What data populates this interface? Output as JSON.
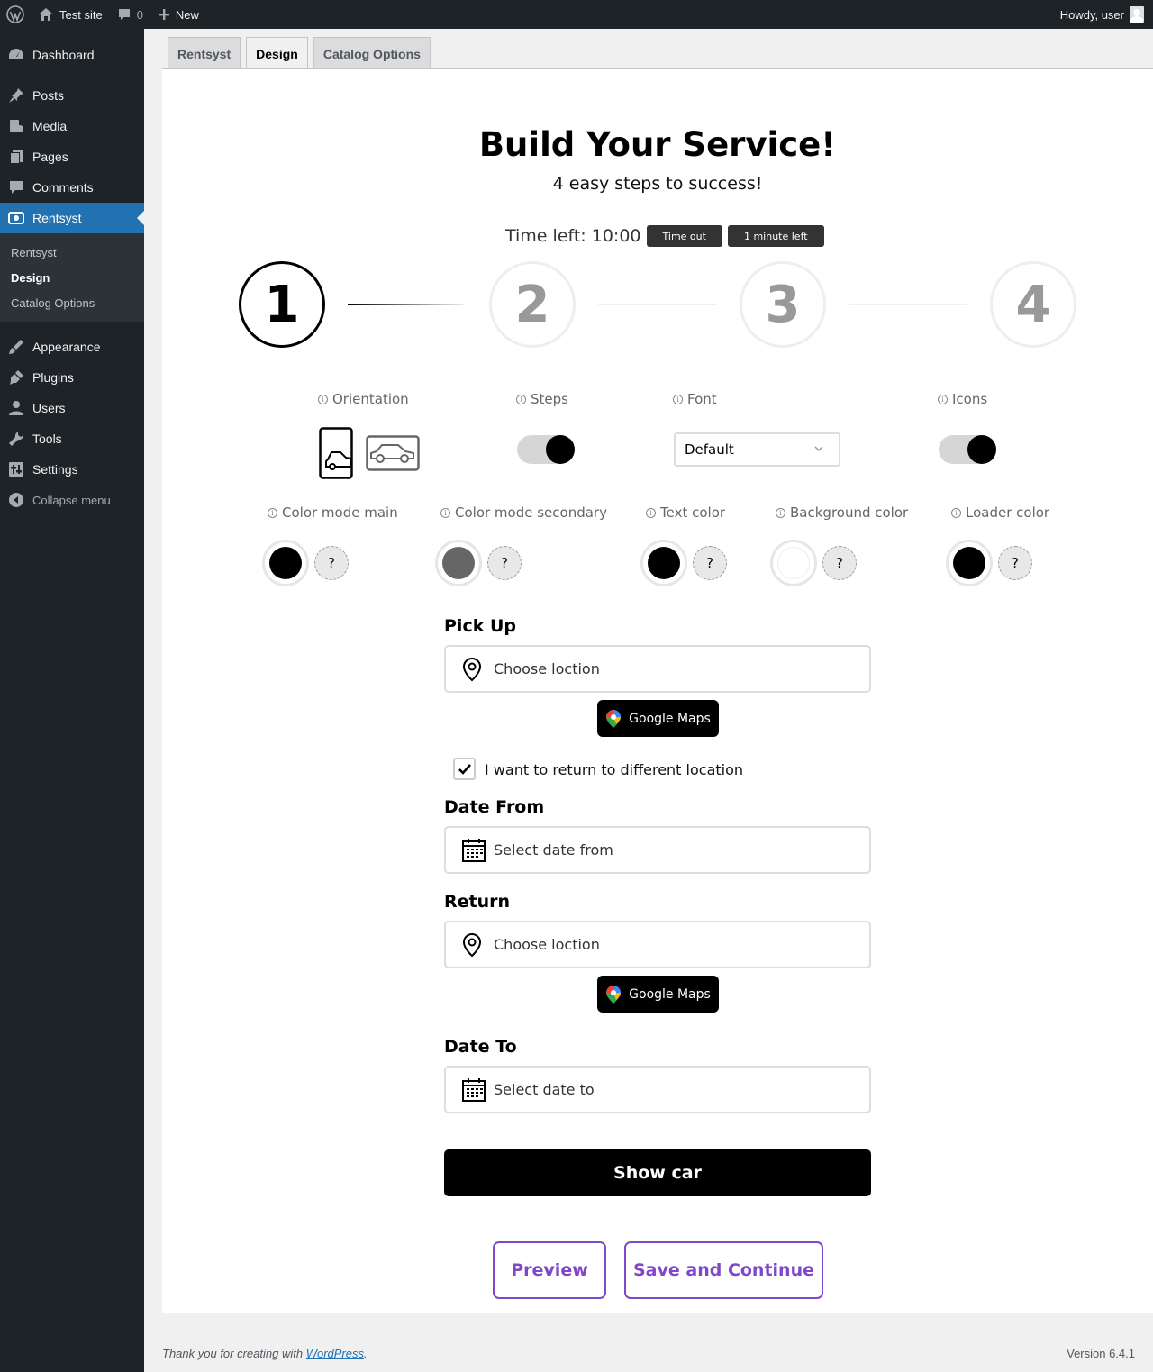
{
  "adminbar": {
    "site_name": "Test site",
    "comments_count": "0",
    "new_label": "New",
    "howdy": "Howdy, user"
  },
  "sidebar": {
    "items": [
      {
        "label": "Dashboard",
        "icon": "dashboard-icon"
      },
      {
        "label": "Posts",
        "icon": "pin-icon"
      },
      {
        "label": "Media",
        "icon": "media-icon"
      },
      {
        "label": "Pages",
        "icon": "pages-icon"
      },
      {
        "label": "Comments",
        "icon": "comment-icon"
      },
      {
        "label": "Rentsyst",
        "icon": "rentsyst-icon"
      },
      {
        "label": "Appearance",
        "icon": "brush-icon"
      },
      {
        "label": "Plugins",
        "icon": "plug-icon"
      },
      {
        "label": "Users",
        "icon": "user-icon"
      },
      {
        "label": "Tools",
        "icon": "wrench-icon"
      },
      {
        "label": "Settings",
        "icon": "settings-icon"
      }
    ],
    "submenu": [
      "Rentsyst",
      "Design",
      "Catalog Options"
    ],
    "collapse_label": "Collapse menu"
  },
  "tabs": [
    "Rentsyst",
    "Design",
    "Catalog Options"
  ],
  "builder": {
    "title": "Build Your Service!",
    "subtitle": "4 easy steps to success!",
    "time_left": "Time left: 10:00",
    "time_out_label": "Time out",
    "one_minute_label": "1 minute left",
    "steps": [
      "1",
      "2",
      "3",
      "4"
    ],
    "options": {
      "orientation": "Orientation",
      "steps": "Steps",
      "font": "Font",
      "icons": "Icons",
      "font_value": "Default"
    },
    "colors": {
      "main": {
        "label": "Color mode main",
        "value": "#000000"
      },
      "secondary": {
        "label": "Color mode secondary",
        "value": "#666666"
      },
      "text": {
        "label": "Text color",
        "value": "#000000"
      },
      "background": {
        "label": "Background color",
        "value": "#ffffff"
      },
      "loader": {
        "label": "Loader color",
        "value": "#000000"
      },
      "question": "?"
    }
  },
  "form": {
    "pickup_label": "Pick Up",
    "pickup_placeholder": "Choose loction",
    "google_maps": "Google Maps",
    "return_checkbox_label": "I want to return to different location",
    "date_from_label": "Date From",
    "date_from_placeholder": "Select date from",
    "return_label": "Return",
    "return_placeholder": "Choose loction",
    "date_to_label": "Date To",
    "date_to_placeholder": "Select date to",
    "show_car": "Show car"
  },
  "actions": {
    "preview": "Preview",
    "save": "Save and Continue"
  },
  "footer": {
    "thanks_prefix": "Thank you for creating with ",
    "wordpress_link": "WordPress",
    "thanks_suffix": ".",
    "version": "Version 6.4.1"
  },
  "accent_color": "#2271b1",
  "button_outline_color": "#7e48c8"
}
